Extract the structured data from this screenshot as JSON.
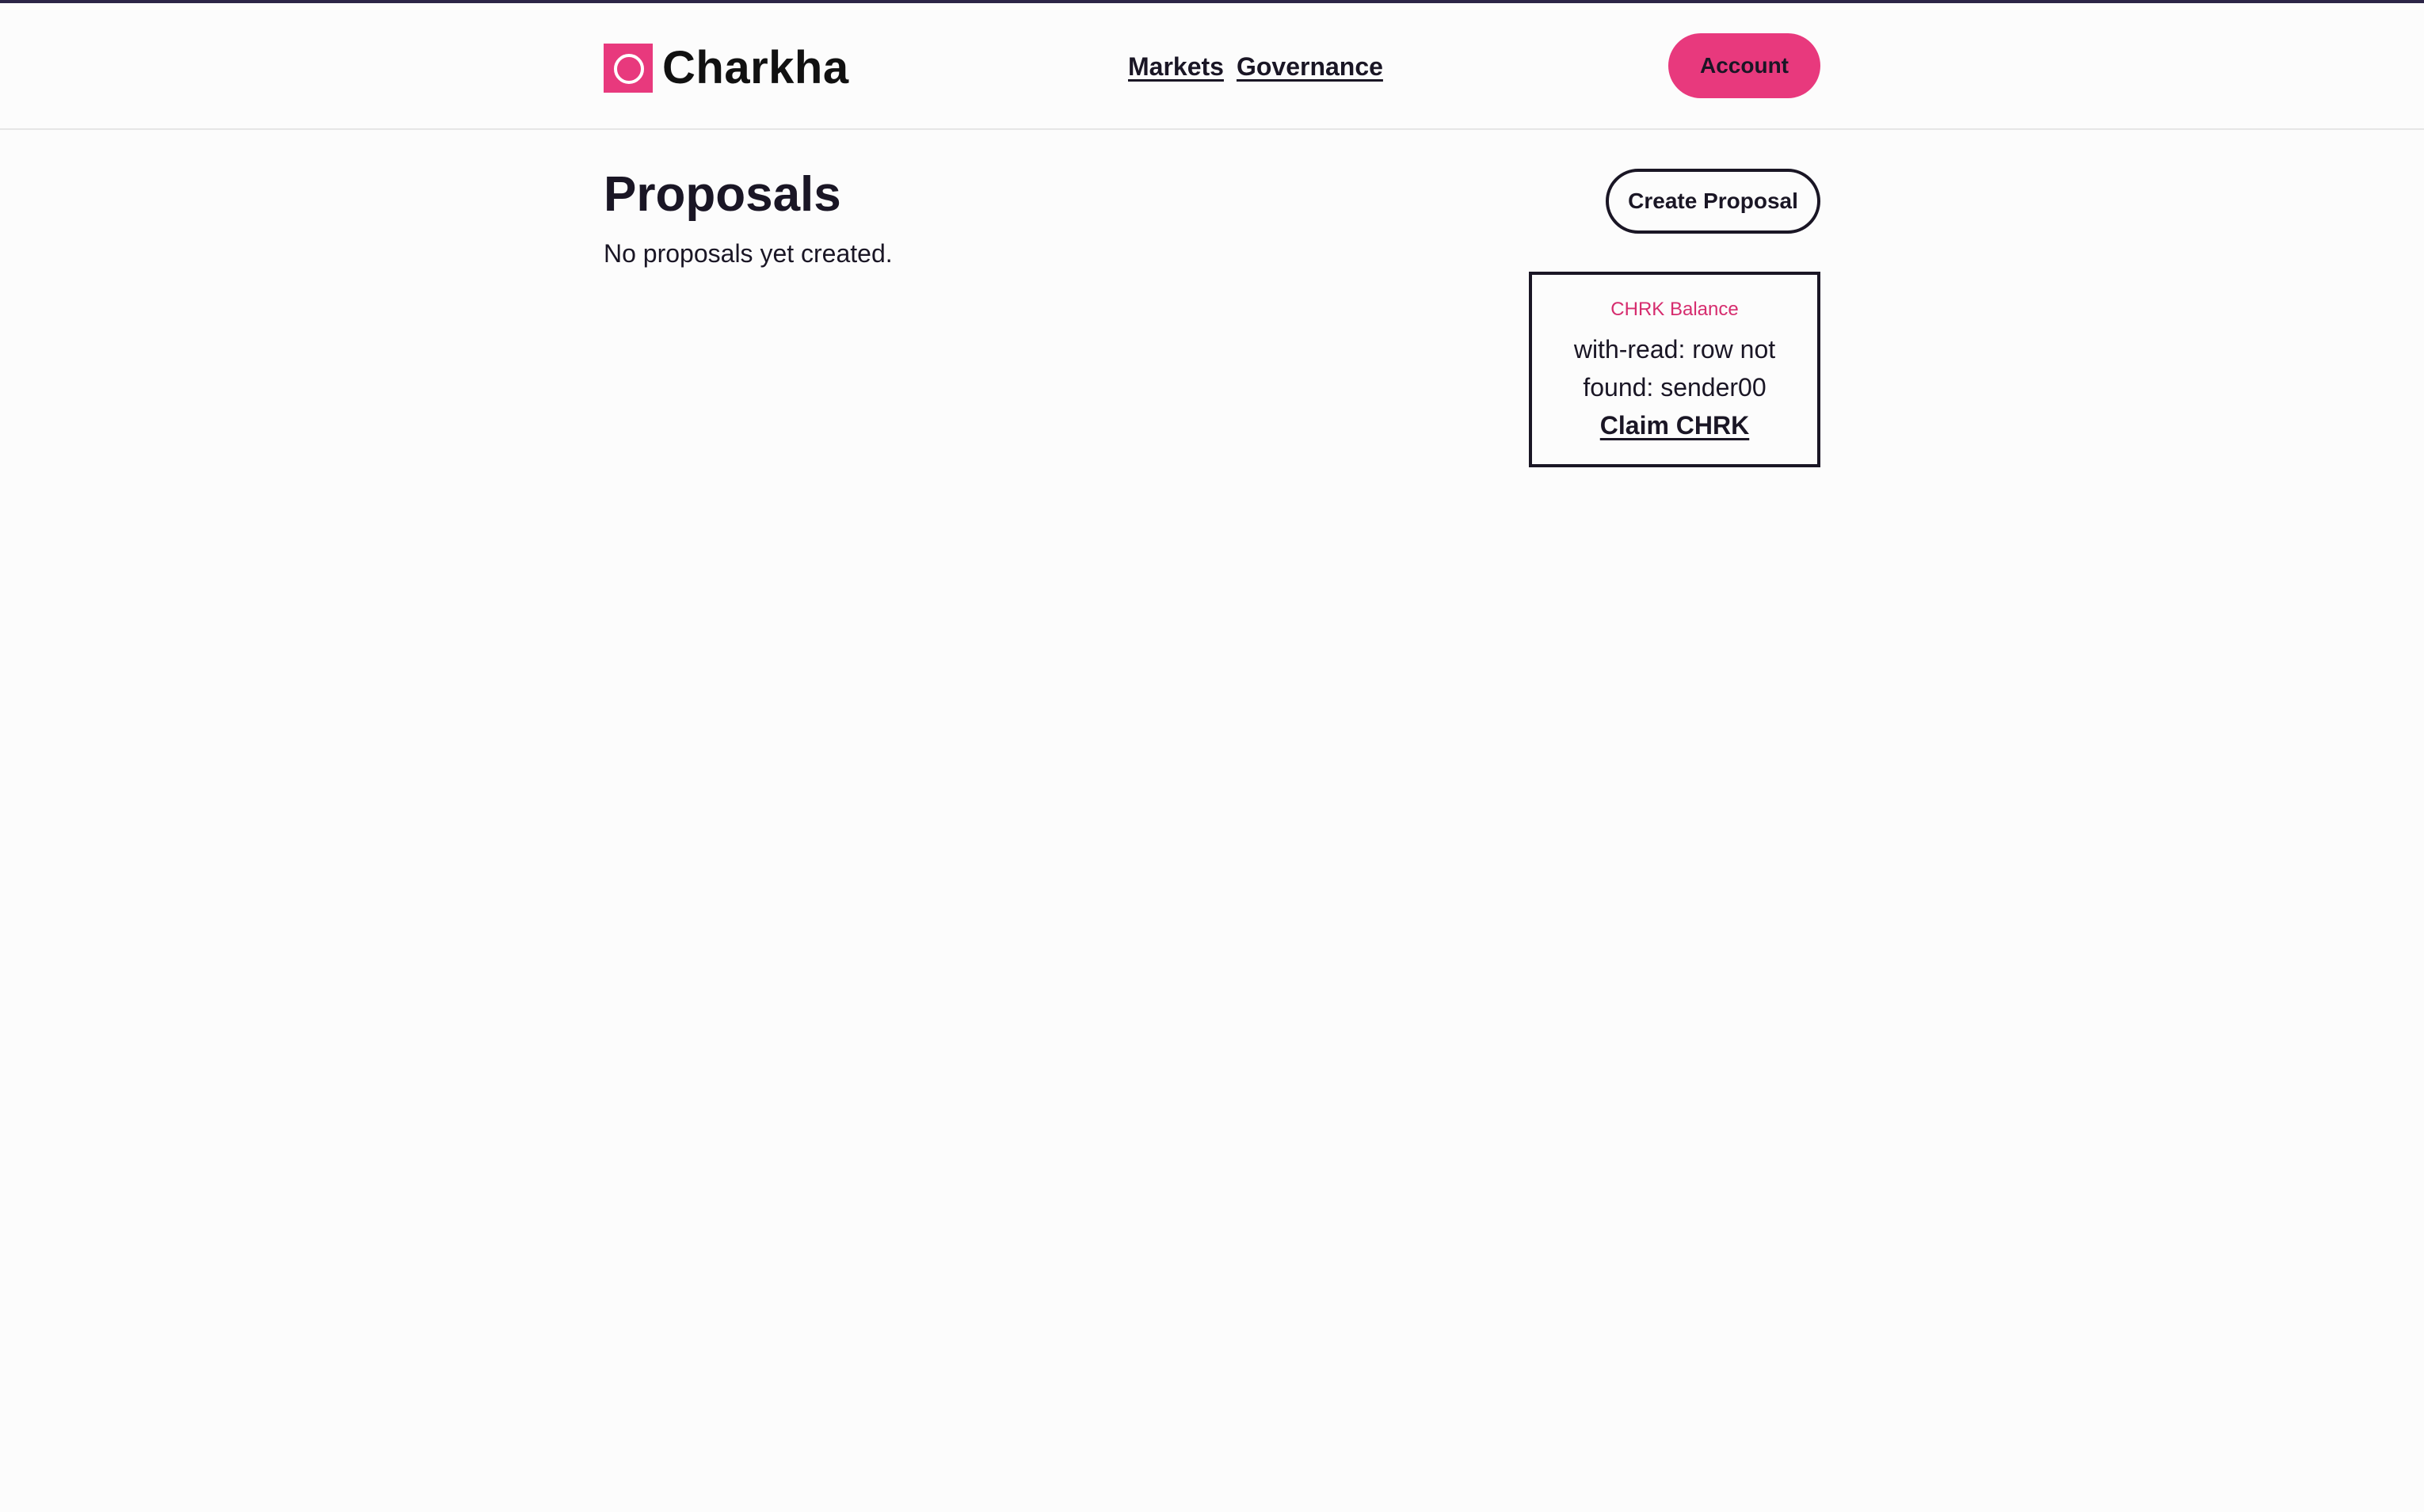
{
  "header": {
    "brand": "Charkha",
    "nav": [
      {
        "label": "Markets"
      },
      {
        "label": "Governance"
      }
    ],
    "account_label": "Account"
  },
  "main": {
    "title": "Proposals",
    "empty_message": "No proposals yet created.",
    "create_label": "Create Proposal"
  },
  "balance_card": {
    "label": "CHRK Balance",
    "error": "with-read: row not found: sender00",
    "claim_label": "Claim CHRK"
  },
  "colors": {
    "accent": "#e8397d",
    "accent_text": "#d62c6e",
    "text": "#1a1625",
    "background": "#fcfcfc",
    "top_strip": "#2c2547"
  },
  "icons": {
    "logo": "charkha-logo-icon"
  }
}
